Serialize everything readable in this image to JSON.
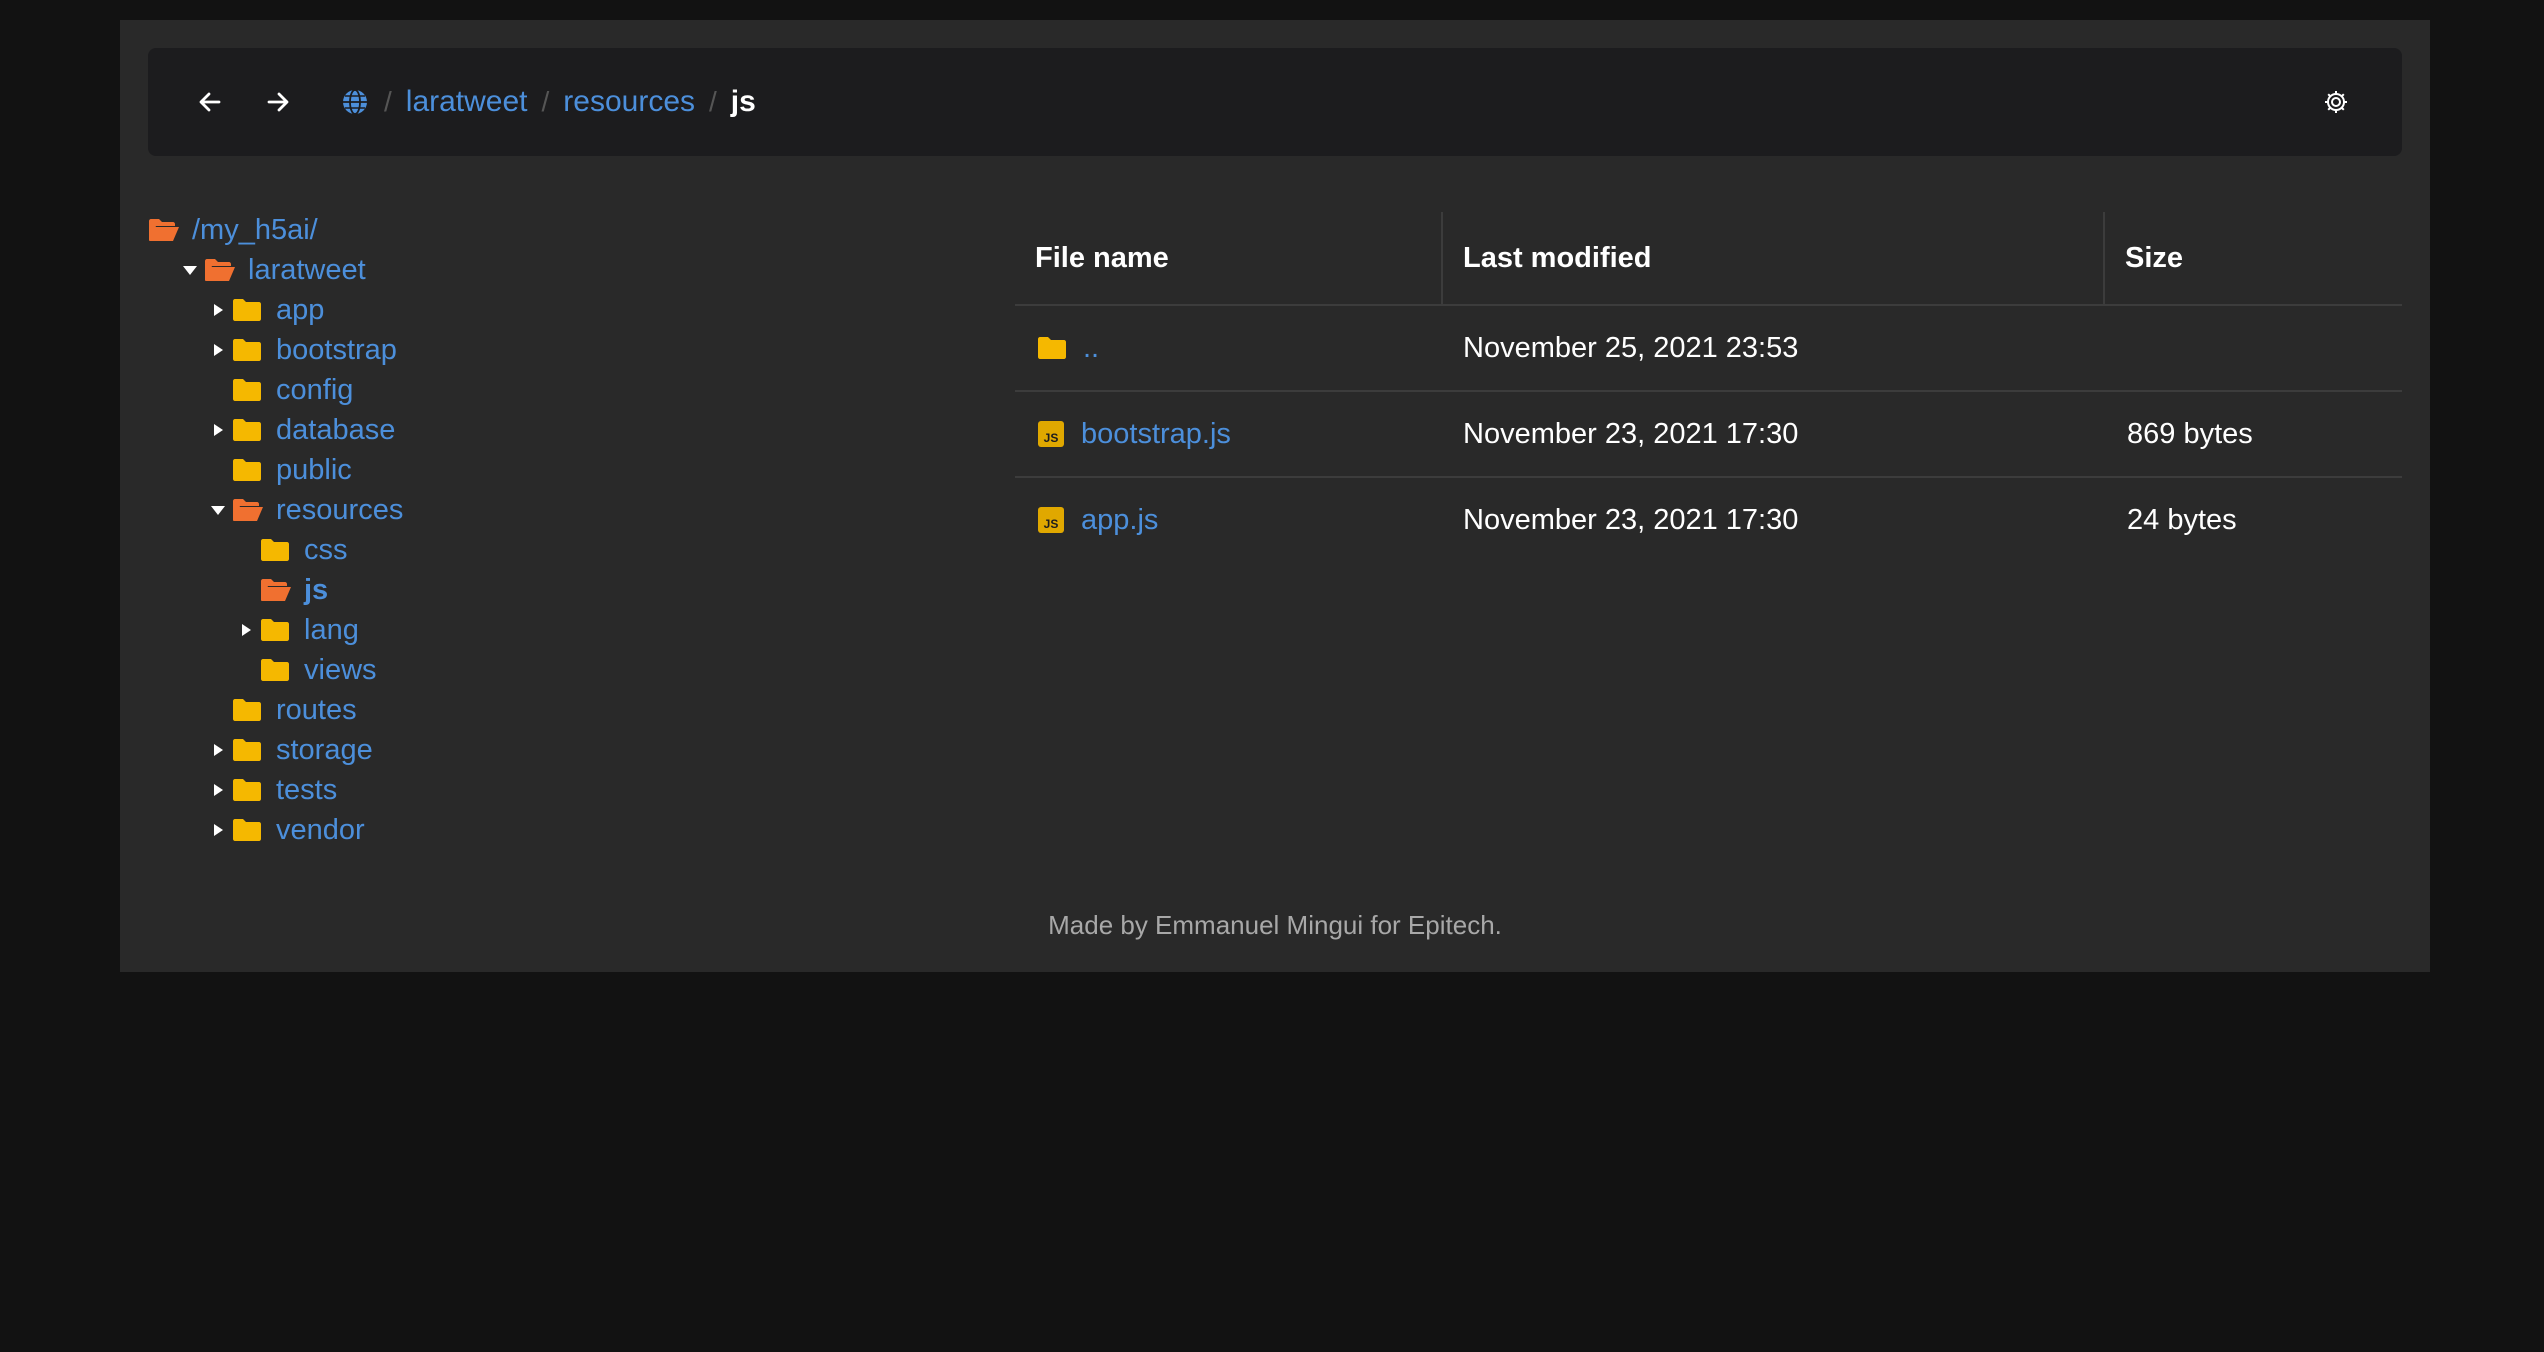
{
  "colors": {
    "background": "#121212",
    "panel": "#292929",
    "topbar": "#1c1c1e",
    "link": "#4c8fdb",
    "folder": "#f5b800",
    "folder_open": "#f07030",
    "js_badge": "#e0a800"
  },
  "header": {
    "back_icon": "arrow-left-icon",
    "forward_icon": "arrow-right-icon",
    "home_icon": "globe-icon",
    "settings_icon": "gear-icon",
    "breadcrumbs": [
      {
        "label": "laratweet"
      },
      {
        "label": "resources"
      },
      {
        "label": "js",
        "current": true
      }
    ]
  },
  "tree": {
    "items": [
      {
        "label": "/my_h5ai/",
        "depth": 0,
        "toggle": "none",
        "open": true
      },
      {
        "label": "laratweet",
        "depth": 1,
        "toggle": "expanded",
        "open": true
      },
      {
        "label": "app",
        "depth": 2,
        "toggle": "collapsed",
        "open": false
      },
      {
        "label": "bootstrap",
        "depth": 2,
        "toggle": "collapsed",
        "open": false
      },
      {
        "label": "config",
        "depth": 2,
        "toggle": "none",
        "open": false
      },
      {
        "label": "database",
        "depth": 2,
        "toggle": "collapsed",
        "open": false
      },
      {
        "label": "public",
        "depth": 2,
        "toggle": "none",
        "open": false
      },
      {
        "label": "resources",
        "depth": 2,
        "toggle": "expanded",
        "open": true
      },
      {
        "label": "css",
        "depth": 3,
        "toggle": "none",
        "open": false
      },
      {
        "label": "js",
        "depth": 3,
        "toggle": "none",
        "open": true,
        "current": true
      },
      {
        "label": "lang",
        "depth": 3,
        "toggle": "collapsed",
        "open": false
      },
      {
        "label": "views",
        "depth": 3,
        "toggle": "none",
        "open": false
      },
      {
        "label": "routes",
        "depth": 2,
        "toggle": "none",
        "open": false
      },
      {
        "label": "storage",
        "depth": 2,
        "toggle": "collapsed",
        "open": false
      },
      {
        "label": "tests",
        "depth": 2,
        "toggle": "collapsed",
        "open": false
      },
      {
        "label": "vendor",
        "depth": 2,
        "toggle": "collapsed",
        "open": false
      }
    ]
  },
  "table": {
    "headers": {
      "name": "File name",
      "modified": "Last modified",
      "size": "Size"
    },
    "rows": [
      {
        "icon": "folder-icon",
        "name": "..",
        "modified": "November 25, 2021 23:53",
        "size": ""
      },
      {
        "icon": "js-file-icon",
        "name": "bootstrap.js",
        "modified": "November 23, 2021 17:30",
        "size": "869 bytes"
      },
      {
        "icon": "js-file-icon",
        "name": "app.js",
        "modified": "November 23, 2021 17:30",
        "size": "24 bytes"
      }
    ]
  },
  "footer": {
    "text": "Made by Emmanuel Mingui for Epitech."
  }
}
